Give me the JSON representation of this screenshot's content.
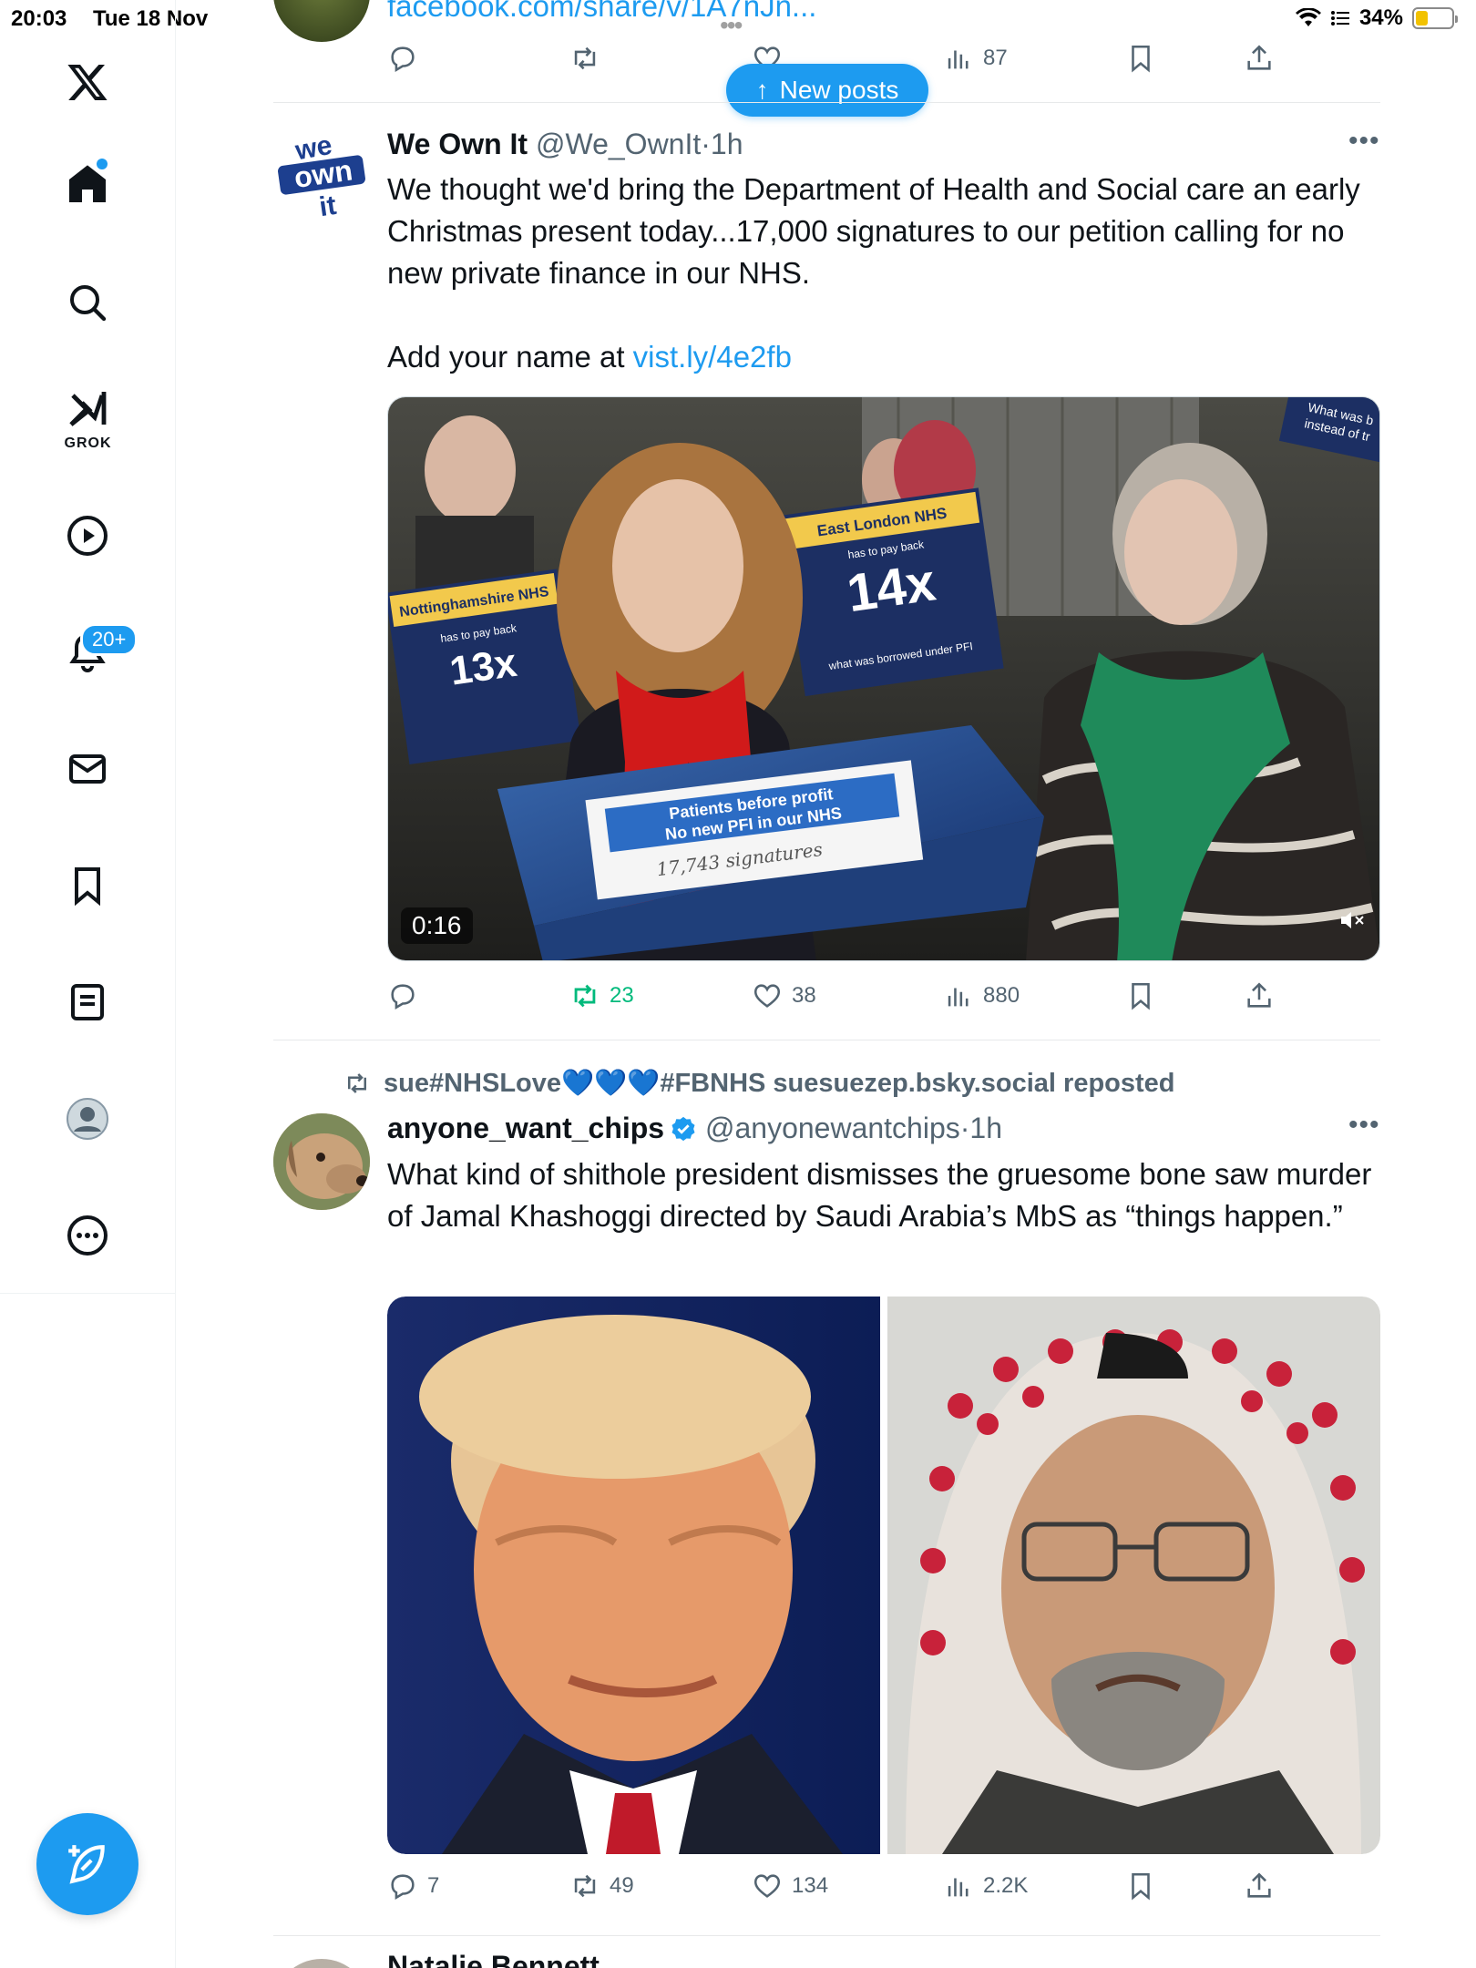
{
  "status_bar": {
    "time": "20:03",
    "date": "Tue 18 Nov",
    "battery": "34%",
    "battery_level": 0.34
  },
  "sidebar": {
    "grok_label": "GROK",
    "notifications_badge": "20+",
    "items": [
      {
        "name": "home-icon"
      },
      {
        "name": "search-icon"
      },
      {
        "name": "grok-icon"
      },
      {
        "name": "video-icon"
      },
      {
        "name": "notifications-icon"
      },
      {
        "name": "messages-icon"
      },
      {
        "name": "bookmarks-icon"
      },
      {
        "name": "lists-icon"
      },
      {
        "name": "profile-icon"
      },
      {
        "name": "more-icon"
      }
    ],
    "accent": "#1d9bf0"
  },
  "new_posts": {
    "label": "New posts"
  },
  "previous_post": {
    "link": "facebook.com/share/v/1A7nJn...",
    "actions": {
      "reply": "",
      "repost": "",
      "like": "",
      "views": "87"
    }
  },
  "tweet1": {
    "name": "We Own It",
    "handle": "@We_OwnIt",
    "time": "1h",
    "avatar_text": "we own it",
    "text_line": "We thought we'd bring the Department of Health and Social care an early Christmas present today...17,000 signatures to our petition calling for no new private finance in our NHS.",
    "text_prefix": "Add your name at",
    "text_link": "vist.ly/4e2fb",
    "video_time": "0:16",
    "media_caption": "Patients before profit No new PFI in our NHS",
    "media_signatures": "17,743 signatures",
    "sign_left": "Nottinghamshire NHS has to pay back 13x",
    "sign_right": "East London NHS has to pay back 14x",
    "actions": {
      "reply": "",
      "repost": "23",
      "like": "38",
      "views": "880"
    }
  },
  "tweet2": {
    "repost_by": "sue#NHSLove💙💙💙#FBNHS suesuezep.bsky.social reposted",
    "name": "anyone_want_chips",
    "handle": "@anyonewantchips",
    "time": "1h",
    "text": "What kind of shithole president dismisses the gruesome bone saw murder of Jamal Khashoggi directed by Saudi Arabia’s MbS as “things happen.”",
    "actions": {
      "reply": "7",
      "repost": "49",
      "like": "134",
      "views": "2.2K"
    }
  },
  "next_post": {
    "name": "Natalie Bennett"
  }
}
